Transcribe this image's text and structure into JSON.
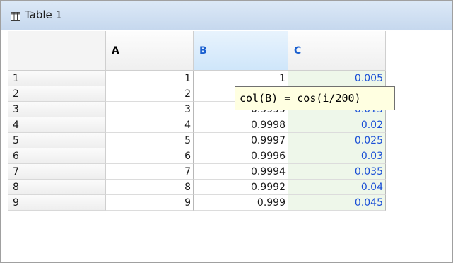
{
  "window": {
    "title": "Table 1",
    "icon": "table-icon"
  },
  "columns": [
    {
      "name": "A"
    },
    {
      "name": "B"
    },
    {
      "name": "C"
    }
  ],
  "rows": [
    {
      "label": "1",
      "a": "1",
      "b": "1",
      "c": "0.005"
    },
    {
      "label": "2",
      "a": "2",
      "b": "",
      "c": ""
    },
    {
      "label": "3",
      "a": "3",
      "b": "0.9999",
      "c": "0.015"
    },
    {
      "label": "4",
      "a": "4",
      "b": "0.9998",
      "c": "0.02"
    },
    {
      "label": "5",
      "a": "5",
      "b": "0.9997",
      "c": "0.025"
    },
    {
      "label": "6",
      "a": "6",
      "b": "0.9996",
      "c": "0.03"
    },
    {
      "label": "7",
      "a": "7",
      "b": "0.9994",
      "c": "0.035"
    },
    {
      "label": "8",
      "a": "8",
      "b": "0.9992",
      "c": "0.04"
    },
    {
      "label": "9",
      "a": "9",
      "b": "0.999",
      "c": "0.045"
    }
  ],
  "tooltip": {
    "text": "col(B) = cos(i/200)"
  },
  "colors": {
    "selected_header": "#cfe6fa",
    "c_column_bg": "#eef7ea",
    "c_column_text": "#1a4fd6"
  }
}
